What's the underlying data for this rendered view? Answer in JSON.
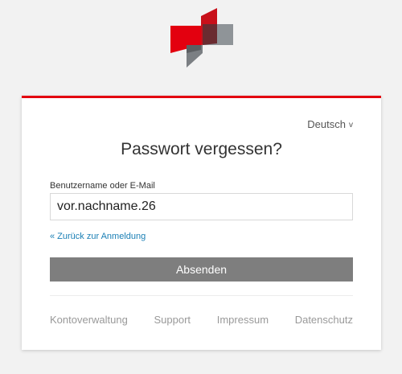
{
  "header": {
    "logo_icon": "brand-logo-icon",
    "accent_color": "#e3000f"
  },
  "card": {
    "language_selector": {
      "label": "Deutsch",
      "chevron": "v"
    },
    "title": "Passwort vergessen?",
    "form": {
      "username_label": "Benutzername oder E-Mail",
      "username_value": "vor.nachname.26"
    },
    "back_link": "« Zurück zur Anmeldung",
    "submit_label": "Absenden",
    "submit_color": "#7e7e7e",
    "link_color": "#1a7fb5"
  },
  "footer": {
    "links": [
      "Kontoverwaltung",
      "Support",
      "Impressum",
      "Datenschutz"
    ]
  }
}
